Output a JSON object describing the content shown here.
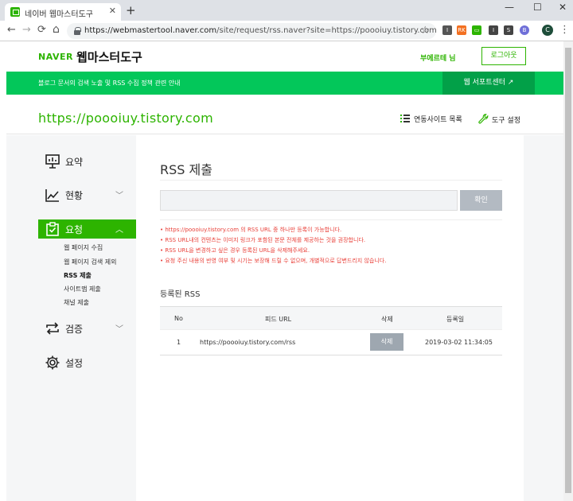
{
  "browser": {
    "tab_title": "네이버 웹마스터도구",
    "tab_close": "✕",
    "new_tab": "+",
    "win_min": "—",
    "win_max": "☐",
    "win_close": "✕",
    "nav_back": "←",
    "nav_forward": "→",
    "nav_reload": "⟳",
    "nav_home": "⌂",
    "url_host": "https://webmastertool.naver.com",
    "url_path": "/site/request/rss.naver?site=https://poooiuy.tistory.com",
    "bookmark": "☆",
    "profile_initial": "C",
    "menu": "⋮",
    "extensions": [
      {
        "name": "ext-1-icon",
        "label": "I",
        "color": "#555555"
      },
      {
        "name": "ext-2-icon",
        "label": "RK",
        "color": "#f37021"
      },
      {
        "name": "ext-3-icon",
        "label": "▭",
        "color": "#2db400"
      },
      {
        "name": "ext-4-icon",
        "label": "I",
        "color": "#444444"
      },
      {
        "name": "ext-5-icon",
        "label": "S",
        "color": "#444444"
      },
      {
        "name": "ext-6-icon",
        "label": "B",
        "color": "#6f6fd8"
      }
    ]
  },
  "header": {
    "logo_naver": "NAVER",
    "logo_title": "웹마스터도구",
    "user_name": "부에르테 님",
    "logout": "로그아웃"
  },
  "notice_bar": {
    "text": "블로그 문서의 검색 노출 및 RSS 수집 정책 관련 안내",
    "support": "웹 서포트센터 ↗"
  },
  "site": {
    "url": "https://poooiuy.tistory.com",
    "linked_sites": "연동사이트 목록",
    "tool_settings": "도구 설정"
  },
  "sidebar": {
    "items": [
      {
        "label": "요약",
        "arrow": ""
      },
      {
        "label": "현황",
        "arrow": "﹀"
      },
      {
        "label": "요청",
        "arrow": "︿"
      },
      {
        "label": "검증",
        "arrow": "﹀"
      },
      {
        "label": "설정",
        "arrow": ""
      }
    ],
    "submenu": [
      "웹 페이지 수집",
      "웹 페이지 검색 제외",
      "RSS 제출",
      "사이트맵 제출",
      "채널 제출"
    ]
  },
  "main": {
    "title": "RSS 제출",
    "input_placeholder": "",
    "confirm": "확인",
    "notices": [
      "• https://poooiuy.tistory.com 의 RSS URL 중 하나만 등록이 가능합니다.",
      "• RSS URL내의 컨텐츠는 이미지 링크가 포함된 본문 전체를 제공하는 것을 권장합니다.",
      "• RSS URL을 변경하고 싶은 경우 등록된 URL을 삭제해주세요.",
      "• 요청 주신 내용의 반영 여부 및 시기는 보장해 드릴 수 없으며, 개별적으로 답변드리지 않습니다."
    ],
    "registered_title": "등록된 RSS",
    "table": {
      "headers": [
        "No",
        "피드 URL",
        "삭제",
        "등록일"
      ],
      "rows": [
        {
          "no": "1",
          "url": "https://poooiuy.tistory.com/rss",
          "delete": "삭제",
          "date": "2019-03-02 11:34:05"
        }
      ]
    }
  },
  "colors": {
    "brand_green": "#2db400",
    "notice_red": "#e9413a",
    "notice_bar": "#03c75a"
  }
}
